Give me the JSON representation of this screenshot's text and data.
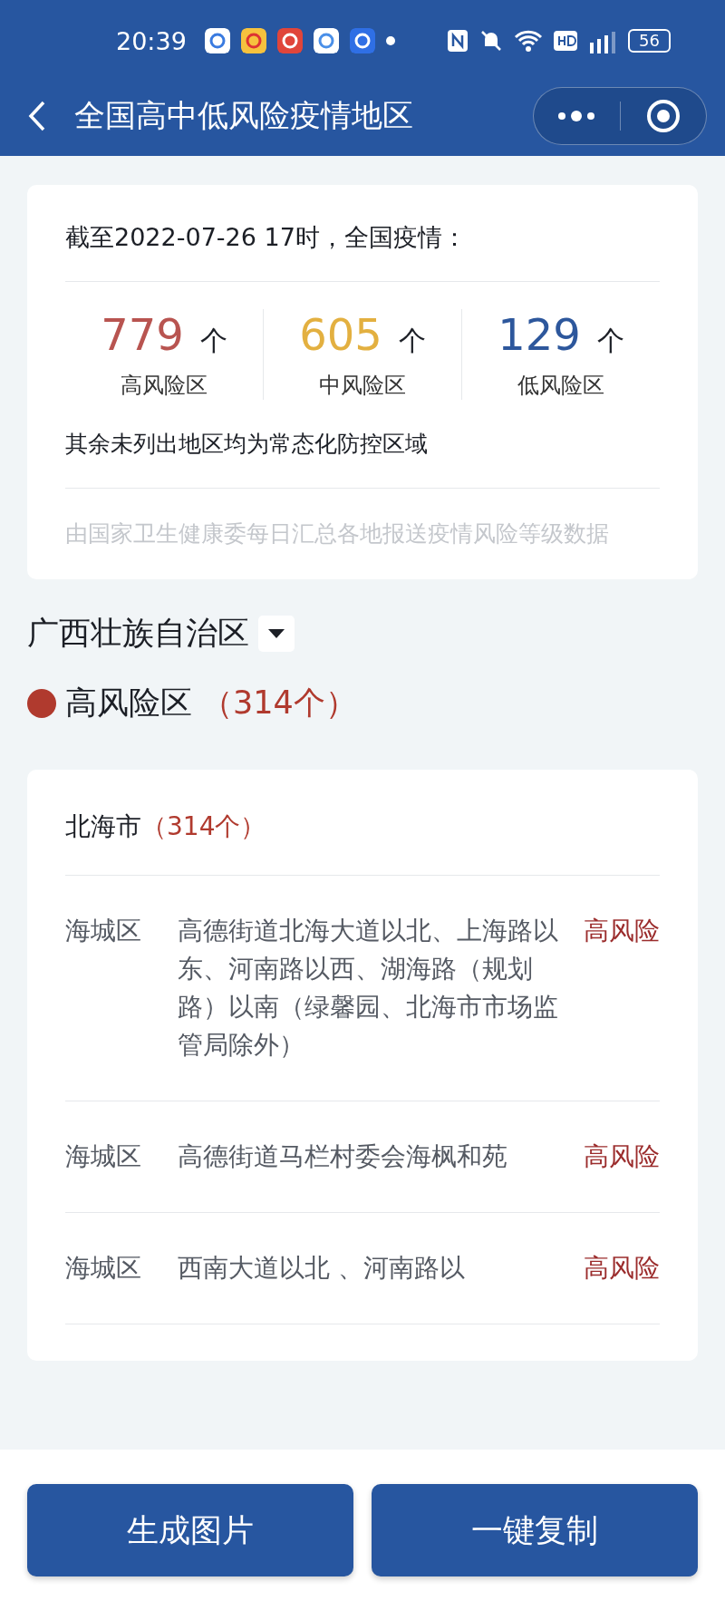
{
  "status_bar": {
    "time": "20:39",
    "battery": "56"
  },
  "nav": {
    "title": "全国高中低风险疫情地区"
  },
  "summary": {
    "heading": "截至2022-07-26 17时，全国疫情：",
    "stats": [
      {
        "count": "779",
        "unit": "个",
        "label": "高风险区",
        "color": "#b85450"
      },
      {
        "count": "605",
        "unit": "个",
        "label": "中风险区",
        "color": "#e3b040"
      },
      {
        "count": "129",
        "unit": "个",
        "label": "低风险区",
        "color": "#2d579c"
      }
    ],
    "note": "其余未列出地区均为常态化防控区域",
    "source": "由国家卫生健康委每日汇总各地报送疫情风险等级数据"
  },
  "region": {
    "name": "广西壮族自治区"
  },
  "level_section": {
    "label": "高风险区",
    "count": "（314个）",
    "color": "#b03a2e"
  },
  "city": {
    "name": "北海市",
    "count": "（314个）",
    "rows": [
      {
        "district": "海城区",
        "area": "高德街道北海大道以北、上海路以东、河南路以西、湖海路（规划路）以南（绿馨园、北海市市场监管局除外）",
        "risk": "高风险"
      },
      {
        "district": "海城区",
        "area": "高德街道马栏村委会海枫和苑",
        "risk": "高风险"
      },
      {
        "district": "海城区",
        "area": "西南大道以北 、河南路以",
        "risk": "高风险"
      }
    ]
  },
  "buttons": [
    "生成图片",
    "一键复制"
  ]
}
